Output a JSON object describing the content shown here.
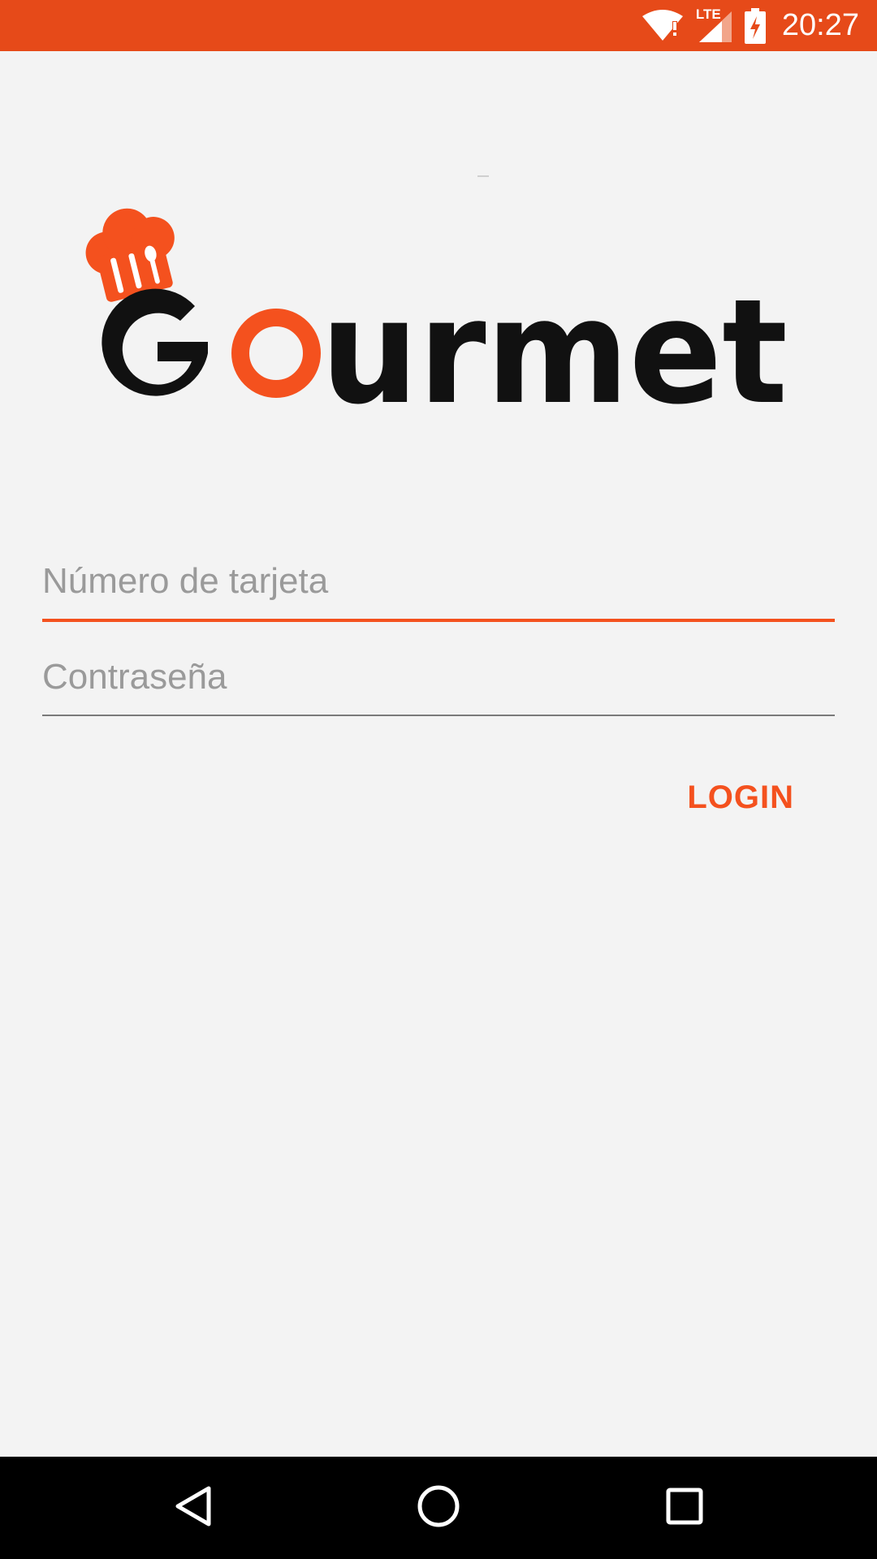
{
  "status_bar": {
    "time": "20:27",
    "network_label": "LTE",
    "icons": [
      "wifi-icon",
      "signal-icon",
      "battery-charging-icon"
    ],
    "background_color": "#e64a19"
  },
  "logo": {
    "text": "Gourmet",
    "brand_color": "#f4511e",
    "icons": [
      "chef-hat-icon"
    ]
  },
  "form": {
    "card_number": {
      "value": "",
      "placeholder": "Número de tarjeta"
    },
    "password": {
      "value": "",
      "placeholder": "Contraseña"
    },
    "login_label": "LOGIN"
  },
  "nav_bar": {
    "icons": [
      "back-icon",
      "home-icon",
      "recents-icon"
    ]
  },
  "colors": {
    "accent": "#f4511e",
    "background": "#f3f3f3",
    "navbar": "#000000"
  }
}
